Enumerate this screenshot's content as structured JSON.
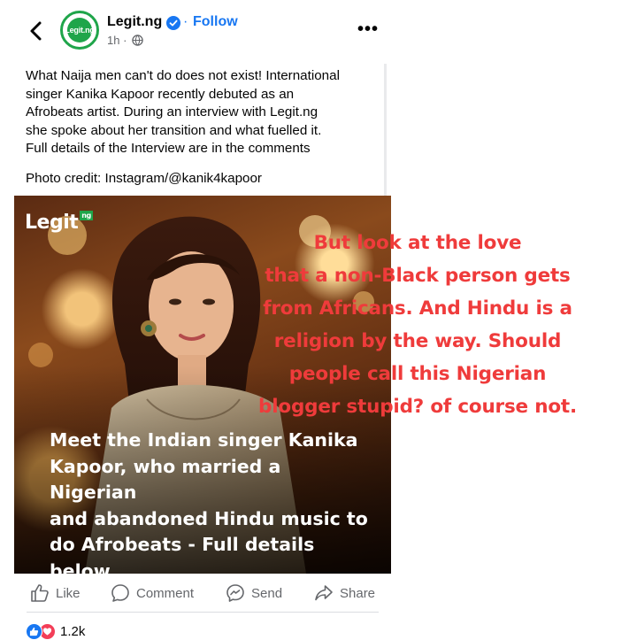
{
  "header": {
    "page_name": "Legit.ng",
    "separator": "·",
    "follow_label": "Follow",
    "time": "1h ·",
    "avatar_text": "Legit.ng",
    "more_label": "•••"
  },
  "post": {
    "caption_lines": [
      "What Naija men can't do does not exist! International",
      "singer Kanika Kapoor recently debuted as an",
      "Afrobeats artist. During an interview with Legit.ng",
      "she spoke about her transition and what fuelled it.",
      "Full details of the Interview are in the comments"
    ],
    "photo_credit": "Photo credit: Instagram/@kanik4kapoor"
  },
  "photo": {
    "logo": "Legit",
    "logo_suffix": "ng",
    "headline_lines": [
      "Meet the Indian singer Kanika",
      "Kapoor, who married a Nigerian",
      "and abandoned Hindu music to",
      "do Afrobeats - Full details below"
    ]
  },
  "overlay": {
    "lines": [
      "But look at the love",
      "that a non-Black person gets",
      "from Africans. And Hindu is a",
      "religion by the way. Should",
      "people call this Nigerian",
      "blogger stupid? of course not."
    ],
    "color": "#ef3b3b"
  },
  "actions": {
    "like": "Like",
    "comment": "Comment",
    "send": "Send",
    "share": "Share"
  },
  "reactions": {
    "count": "1.2k"
  },
  "colors": {
    "accent": "#1877f2",
    "brand_green": "#1fa54a",
    "muted": "#65676b"
  }
}
